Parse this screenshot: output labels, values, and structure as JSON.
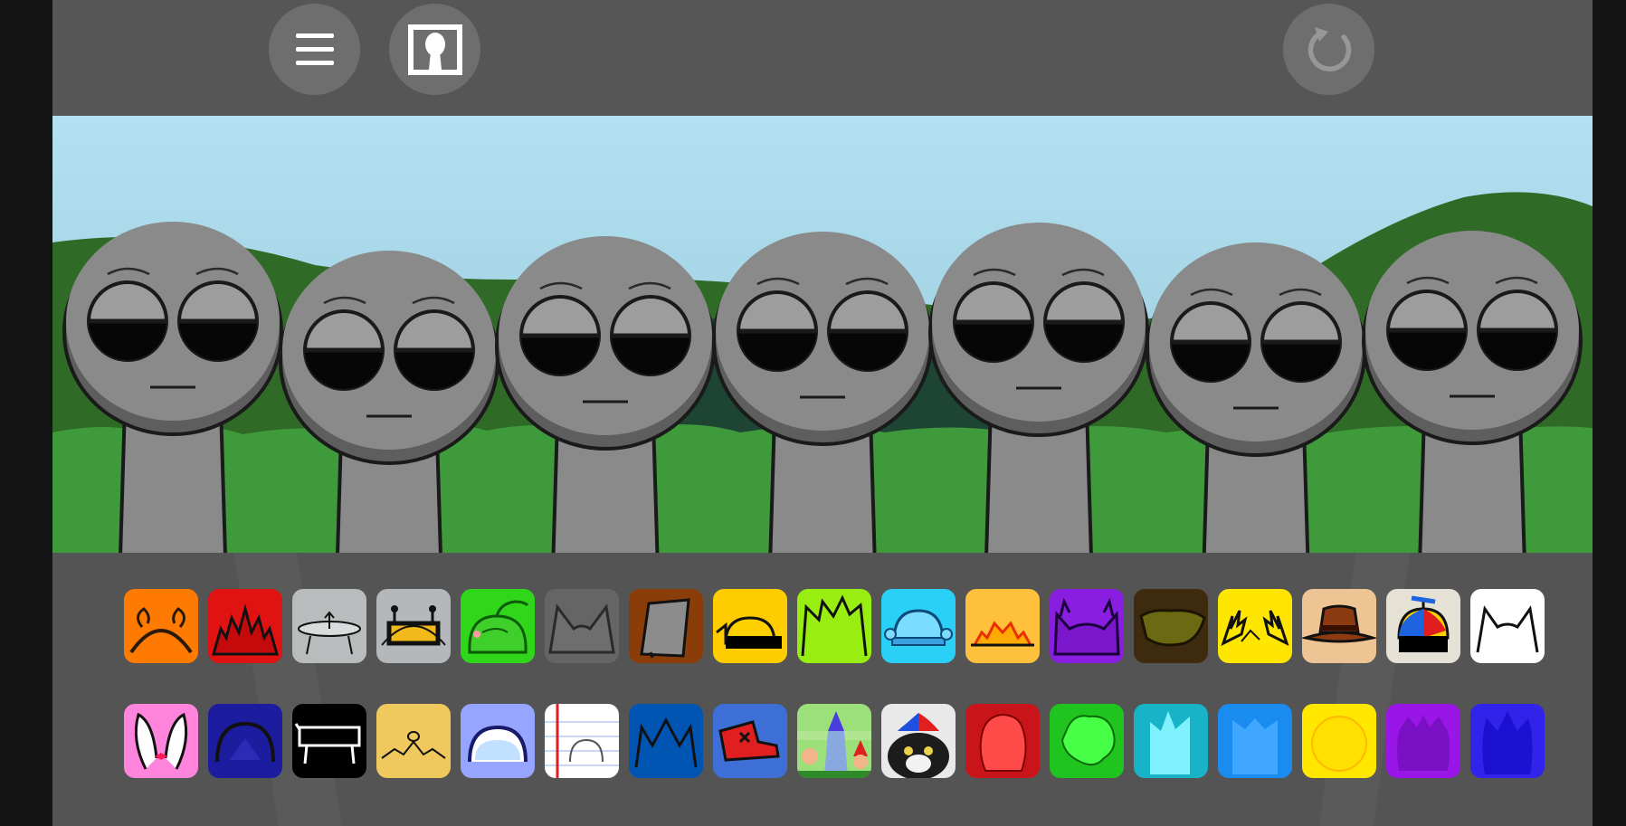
{
  "colors": {
    "background": "#555555",
    "button": "#6e6e6e",
    "sky": "#a8d8ec",
    "grass": "#3f9a3c",
    "character": "#8a8a8a"
  },
  "toolbar": {
    "menu_icon": "hamburger-menu-icon",
    "profile_icon": "keyhole-silhouette-icon",
    "reset_icon": "refresh-icon"
  },
  "characters": [
    {
      "slot": 1,
      "state": "idle"
    },
    {
      "slot": 2,
      "state": "idle"
    },
    {
      "slot": 3,
      "state": "idle"
    },
    {
      "slot": 4,
      "state": "idle"
    },
    {
      "slot": 5,
      "state": "idle"
    },
    {
      "slot": 6,
      "state": "idle"
    },
    {
      "slot": 7,
      "state": "idle"
    }
  ],
  "sound_icons": {
    "row1": [
      {
        "name": "headband-antennae",
        "color": "#ff7a00"
      },
      {
        "name": "spiky-red",
        "color": "#e01212"
      },
      {
        "name": "ufo-saucer",
        "color": "#b8bcbc"
      },
      {
        "name": "robot-visor",
        "color": "#b5b8ba"
      },
      {
        "name": "green-pepper",
        "color": "#2fd61a"
      },
      {
        "name": "cat-ears-gray",
        "color": "#656565"
      },
      {
        "name": "gray-bucket",
        "color": "#8a3d08"
      },
      {
        "name": "yellow-helmet",
        "color": "#ffcc00"
      },
      {
        "name": "lime-spiky-hair",
        "color": "#99ee11"
      },
      {
        "name": "blue-beanie",
        "color": "#2ad0f6"
      },
      {
        "name": "sunrise-hair",
        "color": "#ffc13b"
      },
      {
        "name": "purple-horns",
        "color": "#8a1ee0"
      },
      {
        "name": "dark-brown-hair",
        "color": "#3d2a0f"
      },
      {
        "name": "yellow-lightning",
        "color": "#ffe600"
      },
      {
        "name": "brown-fedora",
        "color": "#efc494"
      },
      {
        "name": "propeller-cap",
        "color": "#e5e1d5"
      },
      {
        "name": "white-cat-ears",
        "color": "#ffffff"
      }
    ],
    "row2": [
      {
        "name": "bunny-ears",
        "color": "#ff84dc"
      },
      {
        "name": "navy-dome",
        "color": "#1c1c9e"
      },
      {
        "name": "black-bench",
        "color": "#000000"
      },
      {
        "name": "tan-crown",
        "color": "#f0c95e"
      },
      {
        "name": "blue-cloud-dome",
        "color": "#96a5ff"
      },
      {
        "name": "notebook-paper",
        "color": "#ffffff"
      },
      {
        "name": "blue-crown",
        "color": "#0055b3"
      },
      {
        "name": "red-cap",
        "color": "#3d6fd6"
      },
      {
        "name": "gnome-scene",
        "color": "#7ad15a"
      },
      {
        "name": "cat-with-propeller",
        "color": "#e9e9e9"
      },
      {
        "name": "red-blob",
        "color": "#c9151a"
      },
      {
        "name": "green-blob",
        "color": "#1fc41f"
      },
      {
        "name": "cyan-spiky",
        "color": "#18b3c6"
      },
      {
        "name": "blue-spiky",
        "color": "#1a8cf0"
      },
      {
        "name": "yellow-fluffy",
        "color": "#ffe700"
      },
      {
        "name": "purple-fluffy",
        "color": "#9a16e6"
      },
      {
        "name": "indigo-flame",
        "color": "#3123e9"
      }
    ]
  }
}
